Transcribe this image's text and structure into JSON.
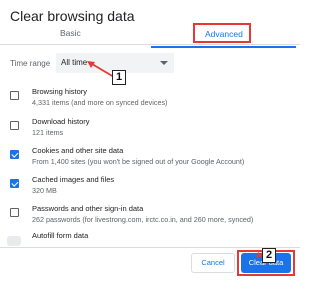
{
  "dialog": {
    "title": "Clear browsing data"
  },
  "tabs": {
    "basic": "Basic",
    "advanced": "Advanced"
  },
  "time_range": {
    "label": "Time range",
    "value": "All time"
  },
  "callouts": {
    "first": "1",
    "second": "2"
  },
  "items": [
    {
      "title": "Browsing history",
      "subtitle": "4,331 items (and more on synced devices)",
      "checked": false
    },
    {
      "title": "Download history",
      "subtitle": "121 items",
      "checked": false
    },
    {
      "title": "Cookies and other site data",
      "subtitle": "From 1,400 sites (you won't be signed out of your Google Account)",
      "checked": true
    },
    {
      "title": "Cached images and files",
      "subtitle": "320 MB",
      "checked": true
    },
    {
      "title": "Passwords and other sign-in data",
      "subtitle": "262 passwords (for livestrong.com, irctc.co.in, and 260 more, synced)",
      "checked": false
    },
    {
      "title": "Autofill form data",
      "subtitle": "",
      "checked": false
    }
  ],
  "buttons": {
    "cancel": "Cancel",
    "clear": "Clear data"
  },
  "colors": {
    "accent": "#1a73e8",
    "annotation": "#e53935"
  }
}
